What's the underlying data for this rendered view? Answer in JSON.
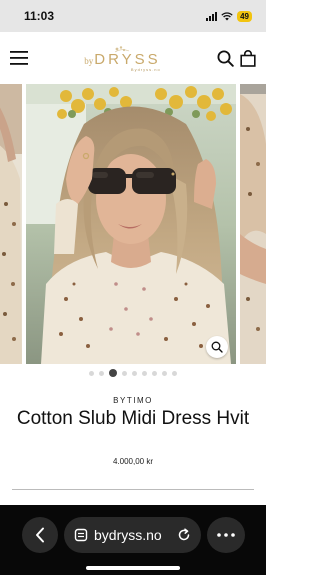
{
  "status_bar": {
    "time": "11:03",
    "battery": "49"
  },
  "header": {
    "logo_prefix": "by",
    "logo_name": "DRYSS",
    "logo_sub": "Bydryss.no"
  },
  "gallery": {
    "slide_count": 9,
    "active_index": 2
  },
  "product": {
    "brand": "BYTIMO",
    "title": "Cotton Slub Midi Dress Hvit",
    "price": "4.000,00 kr"
  },
  "browser": {
    "url": "bydryss.no"
  },
  "colors": {
    "brand_gold": "#c9a96b",
    "battery": "#f2c40f",
    "browser_bg": "#080808",
    "browser_button": "#2a2a2a"
  }
}
